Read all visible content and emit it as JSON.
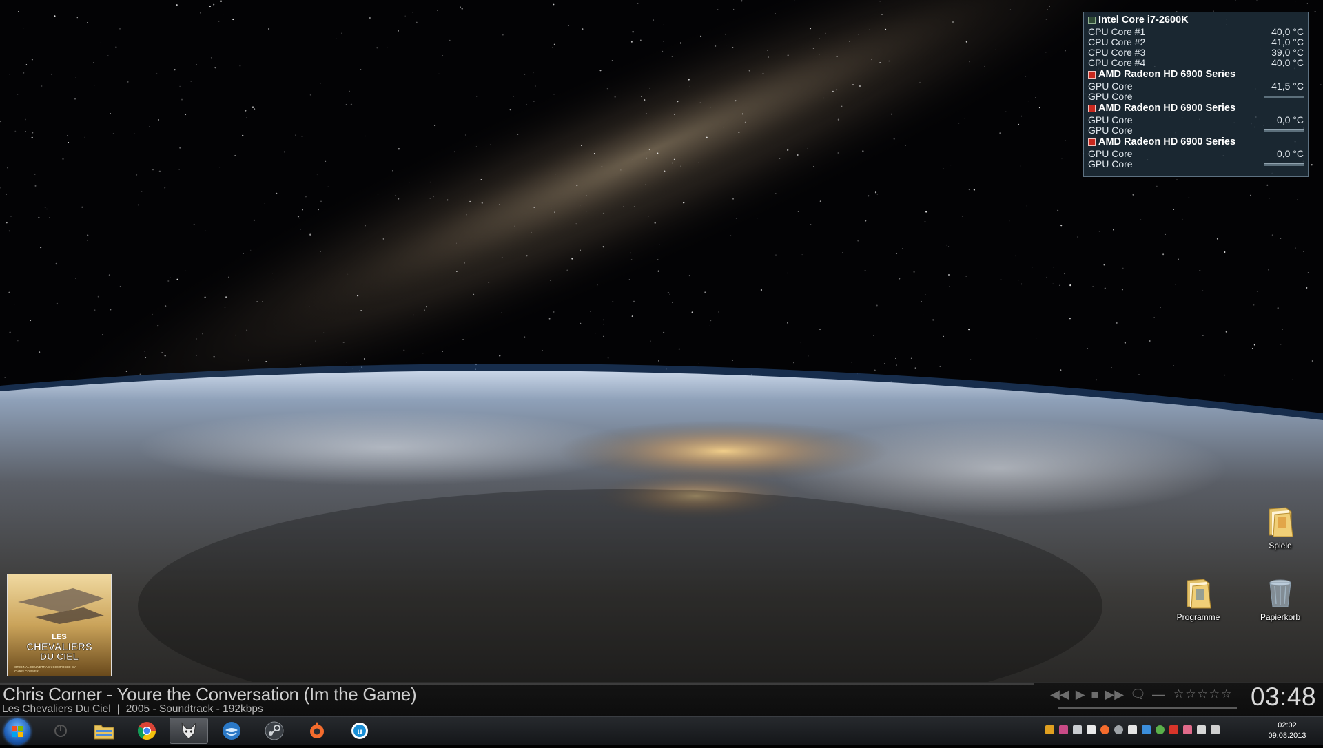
{
  "sensor_gadget": {
    "cpu": {
      "name": "Intel Core i7-2600K",
      "cores": [
        {
          "label": "CPU Core #1",
          "value": "40,0 °C"
        },
        {
          "label": "CPU Core #2",
          "value": "41,0 °C"
        },
        {
          "label": "CPU Core #3",
          "value": "39,0 °C"
        },
        {
          "label": "CPU Core #4",
          "value": "40,0 °C"
        }
      ]
    },
    "gpus": [
      {
        "name": "AMD Radeon HD 6900 Series",
        "temp_label": "GPU Core",
        "temp_value": "41,5 °C",
        "load_label": "GPU Core"
      },
      {
        "name": "AMD Radeon HD 6900 Series",
        "temp_label": "GPU Core",
        "temp_value": "0,0 °C",
        "load_label": "GPU Core"
      },
      {
        "name": "AMD Radeon HD 6900 Series",
        "temp_label": "GPU Core",
        "temp_value": "0,0 °C",
        "load_label": "GPU Core"
      }
    ]
  },
  "desktop_icons": {
    "spiele": "Spiele",
    "programme": "Programme",
    "papierkorb": "Papierkorb"
  },
  "album_art": {
    "line1": "LES",
    "line2": "CHEVALIERS",
    "line3": "DU CIEL",
    "credit1": "ORIGINAL SOUNDTRACK COMPOSED BY",
    "credit2": "CHRIS CORNER"
  },
  "now_playing": {
    "title": "Chris Corner - Youre the Conversation (Im the Game)",
    "album": "Les Chevaliers Du Ciel",
    "separator": "|",
    "details": "2005 - Soundtrack - 192kbps",
    "time": "03:48",
    "rating_stars": 5
  },
  "taskbar": {
    "apps": [
      "start-orb",
      "power",
      "explorer",
      "chrome",
      "foobar",
      "thunderbird",
      "steam",
      "origin",
      "uplay"
    ],
    "active_app": "foobar"
  },
  "clock": {
    "time": "02:02",
    "date": "09.08.2013"
  },
  "colors": {
    "gadget_bg": "#20303c",
    "ati_red": "#c8281e",
    "taskbar": "#1e2124"
  }
}
